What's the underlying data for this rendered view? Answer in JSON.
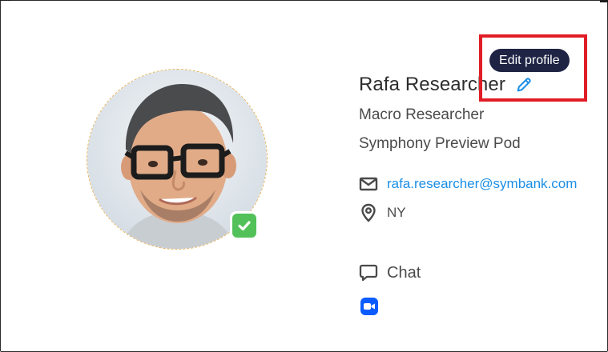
{
  "profile": {
    "name": "Rafa Researcher",
    "title": "Macro Researcher",
    "pod": "Symphony Preview Pod",
    "email": "rafa.researcher@symbank.com",
    "location": "NY",
    "presence": "available"
  },
  "actions": {
    "edit_tooltip": "Edit profile",
    "chat_label": "Chat"
  },
  "icons": {
    "edit": "pencil-icon",
    "email": "envelope-icon",
    "location": "location-pin-icon",
    "chat": "chat-bubble-icon",
    "video": "video-camera-icon",
    "presence": "checkmark-icon"
  },
  "colors": {
    "link": "#1a8ee6",
    "presence_green": "#53c159",
    "tooltip_bg": "#1f2445",
    "highlight_red": "#e01d26",
    "video_blue": "#0b5cff"
  }
}
